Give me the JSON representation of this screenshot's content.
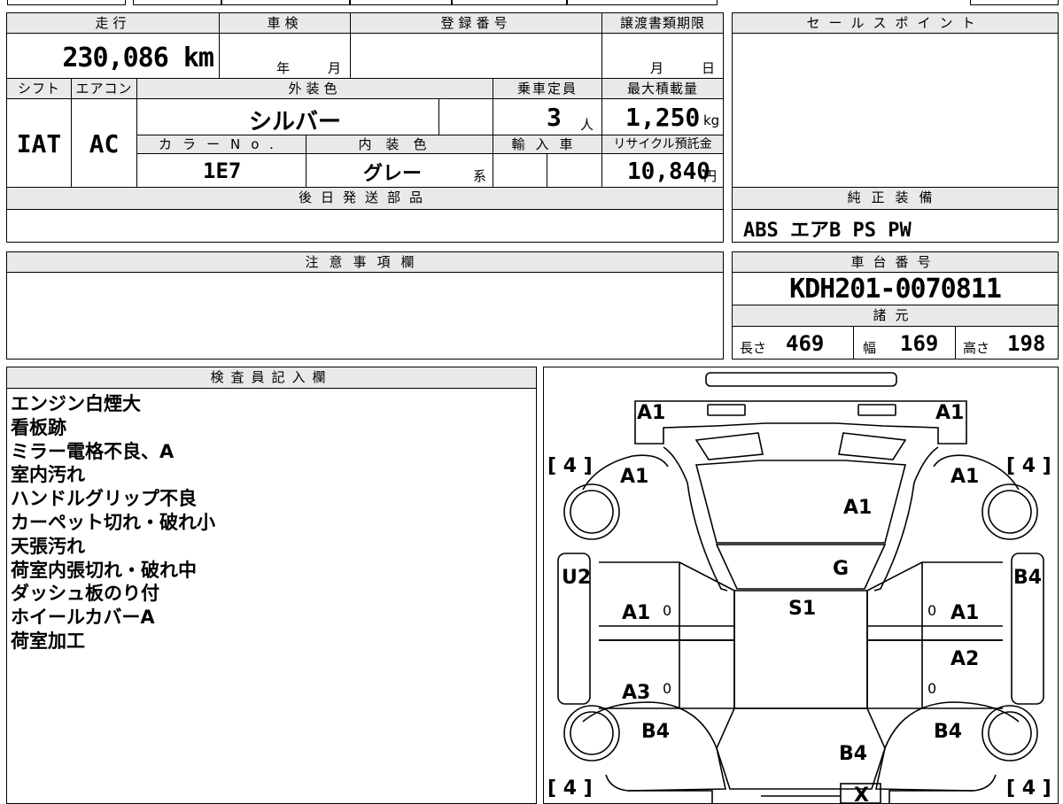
{
  "vehicle": {
    "mileage_label": "走行",
    "mileage_value": "230,086 km",
    "shaken_label": "車検",
    "shaken_year": "年",
    "shaken_month": "月",
    "registration_label": "登録番号",
    "transfer_deadline_label": "譲渡書類期限",
    "transfer_month": "月",
    "transfer_day": "日",
    "shift_label": "シフト",
    "shift_value": "IAT",
    "ac_label": "エアコン",
    "ac_value": "AC",
    "exterior_color_label": "外装色",
    "exterior_color_value": "シルバー",
    "color_no_label": "カラーNo.",
    "color_no_value": "1E7",
    "interior_color_label": "内装色",
    "interior_color_value": "グレー",
    "interior_suffix": "系",
    "capacity_label": "乗車定員",
    "capacity_value": "3",
    "capacity_unit": "人",
    "max_load_label": "最大積載量",
    "max_load_value": "1,250",
    "max_load_unit": "kg",
    "import_label": "輸入車",
    "recycle_label": "リサイクル預託金",
    "recycle_value": "10,840",
    "recycle_unit": "円",
    "later_parts_label": "後日発送部品"
  },
  "sales_point": {
    "label": "セールスポイント"
  },
  "equipment": {
    "label": "純正装備",
    "value": "ABS エアB PS PW"
  },
  "notes": {
    "label": "注意事項欄"
  },
  "chassis": {
    "label": "車台番号",
    "value": "KDH201-0070811"
  },
  "specs": {
    "label": "諸元",
    "length_label": "長さ",
    "length_value": "469",
    "width_label": "幅",
    "width_value": "169",
    "height_label": "高さ",
    "height_value": "198"
  },
  "inspector": {
    "label": "検査員記入欄",
    "items": [
      "エンジン白煙大",
      "看板跡",
      "ミラー電格不良、A",
      "室内汚れ",
      "ハンドルグリップ不良",
      "カーペット切れ・破れ小",
      "天張汚れ",
      "荷室内張切れ・破れ中",
      "ダッシュ板のり付",
      "ホイールカバーA",
      "荷室加工"
    ]
  },
  "diagram": {
    "tire_tl": "[ 4 ]",
    "tire_tr": "[ 4 ]",
    "tire_bl": "[ 4 ]",
    "tire_br": "[ 4 ]",
    "front_left": "A1",
    "front_right": "A1",
    "fender_left": "A1",
    "fender_right": "A1",
    "hood": "A1",
    "windshield": "G",
    "roof": "S1",
    "left_pillar": "U2",
    "right_pillar": "B4",
    "door_l1": "A1",
    "door_l1_mark": "0",
    "door_r1": "A1",
    "door_r1_mark": "0",
    "door_r2": "A2",
    "door_l2": "A3",
    "door_l2_mark": "0",
    "door_r2_mark": "0",
    "rear_fender_left": "B4",
    "rear_fender_right": "B4",
    "tailgate": "B4",
    "rear_bottom": "X"
  }
}
